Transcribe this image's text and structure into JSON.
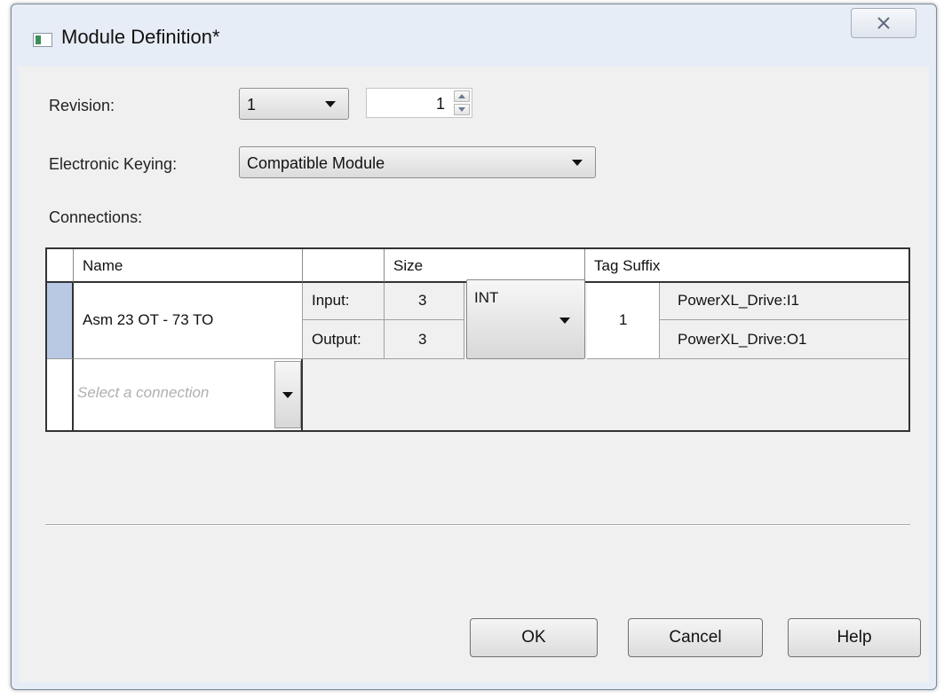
{
  "window": {
    "title": "Module Definition*"
  },
  "revision": {
    "label": "Revision:",
    "major": "1",
    "minor": "1"
  },
  "keying": {
    "label": "Electronic Keying:",
    "value": "Compatible Module"
  },
  "connections": {
    "label": "Connections:",
    "headers": {
      "name": "Name",
      "size": "Size",
      "tag_suffix": "Tag Suffix"
    },
    "row": {
      "name": "Asm 23 OT - 73 TO",
      "input_label": "Input:",
      "input_size": "3",
      "output_label": "Output:",
      "output_size": "3",
      "data_type": "INT",
      "suffix_num": "1",
      "input_tag": "PowerXL_Drive:I1",
      "output_tag": "PowerXL_Drive:O1"
    },
    "new_row_placeholder": "Select a connection"
  },
  "buttons": {
    "ok": "OK",
    "cancel": "Cancel",
    "help": "Help"
  },
  "icons": {
    "close": "close-x-icon",
    "window": "module-icon",
    "dropdown": "caret-down-icon"
  }
}
